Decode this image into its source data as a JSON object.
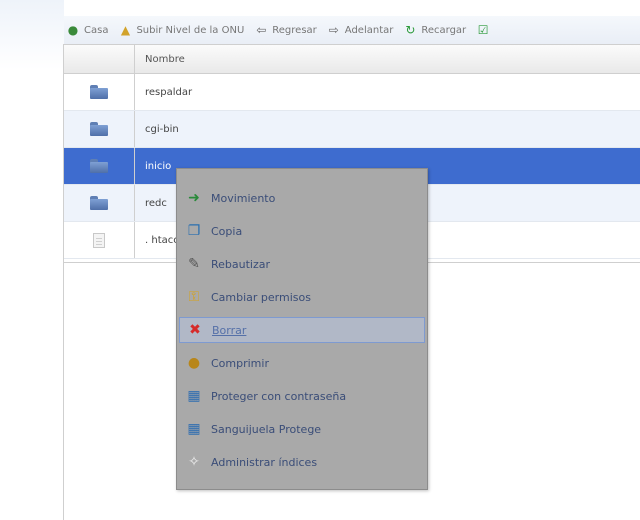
{
  "toolbar": {
    "items": [
      {
        "label": "Casa",
        "icon": "home-icon",
        "glyph": "●",
        "color": "#3a8a3a"
      },
      {
        "label": "Subir Nivel de la ONU",
        "icon": "up-folder-icon",
        "glyph": "▲",
        "color": "#d2a32b"
      },
      {
        "label": "Regresar",
        "icon": "back-arrow-icon",
        "glyph": "⇦",
        "color": "#666666"
      },
      {
        "label": "Adelantar",
        "icon": "forward-arrow-icon",
        "glyph": "⇨",
        "color": "#666666"
      },
      {
        "label": "Recargar",
        "icon": "reload-icon",
        "glyph": "↻",
        "color": "#2b9a3a"
      },
      {
        "label": "",
        "icon": "checkbox-icon",
        "glyph": "☑",
        "color": "#2b9a3a"
      }
    ]
  },
  "table": {
    "header": {
      "name": "Nombre"
    },
    "rows": [
      {
        "name": "respaldar",
        "type": "folder"
      },
      {
        "name": "cgi-bin",
        "type": "folder"
      },
      {
        "name": "inicio",
        "type": "folder",
        "selected": true
      },
      {
        "name": "redc",
        "type": "folder"
      },
      {
        "name": ". htaccess",
        "type": "file"
      }
    ]
  },
  "context_menu": {
    "items": [
      {
        "label": "Movimiento",
        "icon": "move-icon",
        "glyph": "➜",
        "color": "#2a8a3a"
      },
      {
        "label": "Copia",
        "icon": "copy-icon",
        "glyph": "❐",
        "color": "#2a6fb0"
      },
      {
        "label": "Rebautizar",
        "icon": "rename-icon",
        "glyph": "✎",
        "color": "#555555"
      },
      {
        "label": "Cambiar permisos",
        "icon": "key-icon",
        "glyph": "⚿",
        "color": "#d6a21b"
      },
      {
        "label": "Borrar",
        "icon": "delete-icon",
        "glyph": "✖",
        "color": "#d62b2b",
        "hover": true
      },
      {
        "label": "Comprimir",
        "icon": "compress-icon",
        "glyph": "●",
        "color": "#b8861a"
      },
      {
        "label": "Proteger con contraseña",
        "icon": "password-protect-icon",
        "glyph": "▦",
        "color": "#2f6db0"
      },
      {
        "label": "Sanguijuela Protege",
        "icon": "leech-protect-icon",
        "glyph": "▦",
        "color": "#2f6db0"
      },
      {
        "label": "Administrar índices",
        "icon": "manage-indexes-icon",
        "glyph": "✧",
        "color": "#eeeeee"
      }
    ]
  }
}
